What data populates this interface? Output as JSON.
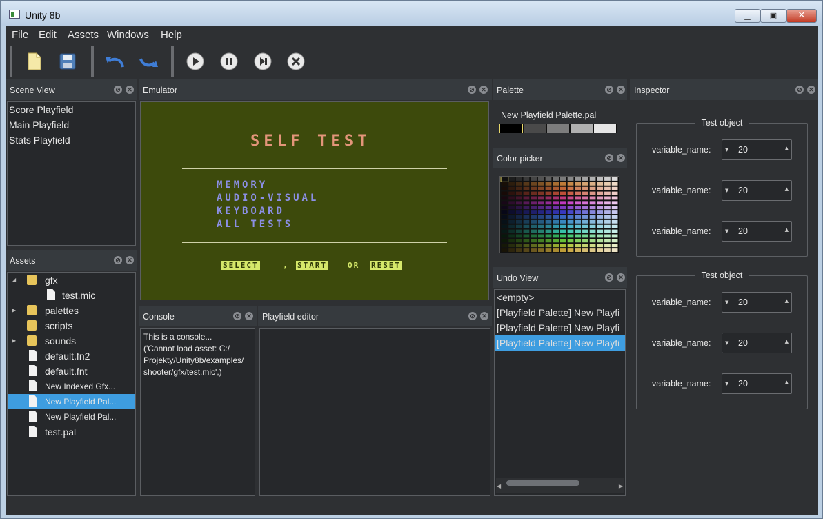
{
  "window": {
    "title": "Unity 8b",
    "min": "▁",
    "max": "▣",
    "close": "✕"
  },
  "menu": [
    "File",
    "Edit",
    "Assets",
    "Windows",
    "Help"
  ],
  "toolbar": {
    "icons": [
      "new-file-icon",
      "save-icon",
      "undo-icon",
      "redo-icon",
      "play-icon",
      "pause-icon",
      "step-icon",
      "stop-icon"
    ]
  },
  "scene_view": {
    "title": "Scene View",
    "items": [
      "Score Playfield",
      "Main Playfield",
      "Stats Playfield"
    ]
  },
  "assets": {
    "title": "Assets",
    "items": [
      {
        "label": "gfx",
        "type": "folder",
        "expanded": true
      },
      {
        "label": "test.mic",
        "type": "file",
        "child": true
      },
      {
        "label": "palettes",
        "type": "folder",
        "expanded": false
      },
      {
        "label": "scripts",
        "type": "folder"
      },
      {
        "label": "sounds",
        "type": "folder",
        "expanded": false
      },
      {
        "label": "default.fn2",
        "type": "file"
      },
      {
        "label": "default.fnt",
        "type": "file"
      },
      {
        "label": "New Indexed Gfx...",
        "type": "file",
        "small": true
      },
      {
        "label": "New Playfield Pal...",
        "type": "file",
        "small": true,
        "selected": true
      },
      {
        "label": "New Playfield Pal...",
        "type": "file",
        "small": true
      },
      {
        "label": "test.pal",
        "type": "file"
      }
    ]
  },
  "emulator": {
    "title": "Emulator",
    "heading": "SELF TEST",
    "menu_items": [
      "MEMORY",
      "AUDIO-VISUAL",
      "KEYBOARD",
      "ALL TESTS"
    ],
    "footer": {
      "select": "SELECT",
      "comma": ",",
      "start": "START",
      "or": "OR",
      "reset": "RESET"
    },
    "colors": {
      "bg": "#3d4a0c",
      "heading": "#e3957a",
      "items": "#8b8fe6",
      "footer_bg": "#d5e86a"
    }
  },
  "console": {
    "title": "Console",
    "lines": [
      "This is a console...",
      "('Cannot load asset: C:/",
      "Projekty/Unity8b/examples/",
      "shooter/gfx/test.mic',)"
    ]
  },
  "playfield_editor": {
    "title": "Playfield editor"
  },
  "palette": {
    "title": "Palette",
    "name": "New Playfield Palette.pal",
    "swatches": [
      "#000000",
      "#4a4a4a",
      "#7d7d7d",
      "#b0b0b0",
      "#e6e6e6"
    ]
  },
  "color_picker": {
    "title": "Color picker"
  },
  "undo_view": {
    "title": "Undo View",
    "items": [
      "<empty>",
      "[Playfield Palette] New Playfi",
      "[Playfield Palette] New Playfi",
      "[Playfield Palette] New Playfi"
    ],
    "selected_index": 3
  },
  "inspector": {
    "title": "Inspector",
    "groups": [
      {
        "title": "Test object",
        "fields": [
          {
            "label": "variable_name:",
            "value": "20"
          },
          {
            "label": "variable_name:",
            "value": "20"
          },
          {
            "label": "variable_name:",
            "value": "20"
          }
        ]
      },
      {
        "title": "Test object",
        "fields": [
          {
            "label": "variable_name:",
            "value": "20"
          },
          {
            "label": "variable_name:",
            "value": "20"
          },
          {
            "label": "variable_name:",
            "value": "20"
          }
        ]
      }
    ]
  }
}
